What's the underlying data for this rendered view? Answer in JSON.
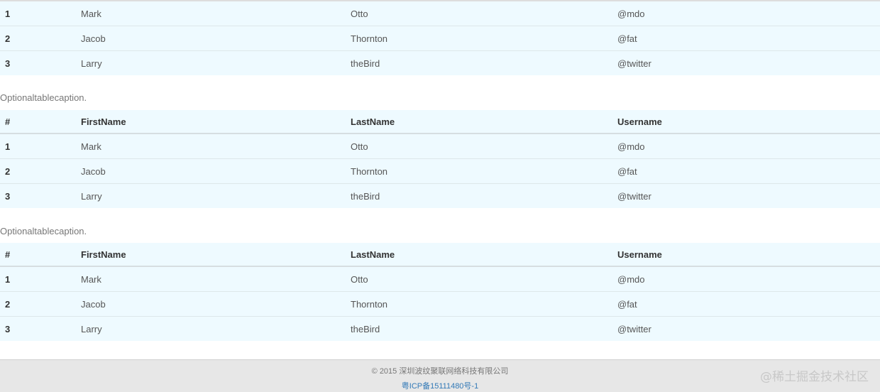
{
  "table1": {
    "rows": [
      {
        "num": "1",
        "first": "Mark",
        "last": "Otto",
        "user": "@mdo"
      },
      {
        "num": "2",
        "first": "Jacob",
        "last": "Thornton",
        "user": "@fat"
      },
      {
        "num": "3",
        "first": "Larry",
        "last": "theBird",
        "user": "@twitter"
      }
    ]
  },
  "table2": {
    "caption": "Optionaltablecaption.",
    "headers": {
      "num": "#",
      "first": "FirstName",
      "last": "LastName",
      "user": "Username"
    },
    "rows": [
      {
        "num": "1",
        "first": "Mark",
        "last": "Otto",
        "user": "@mdo"
      },
      {
        "num": "2",
        "first": "Jacob",
        "last": "Thornton",
        "user": "@fat"
      },
      {
        "num": "3",
        "first": "Larry",
        "last": "theBird",
        "user": "@twitter"
      }
    ]
  },
  "table3": {
    "caption": "Optionaltablecaption.",
    "headers": {
      "num": "#",
      "first": "FirstName",
      "last": "LastName",
      "user": "Username"
    },
    "rows": [
      {
        "num": "1",
        "first": "Mark",
        "last": "Otto",
        "user": "@mdo"
      },
      {
        "num": "2",
        "first": "Jacob",
        "last": "Thornton",
        "user": "@fat"
      },
      {
        "num": "3",
        "first": "Larry",
        "last": "theBird",
        "user": "@twitter"
      }
    ]
  },
  "footer": {
    "copyright": "© 2015 深圳波纹聚联网络科技有限公司",
    "icp": "粤ICP备15111480号-1",
    "watermark": "@稀土掘金技术社区"
  },
  "colors": {
    "row_background": "#eefaff",
    "footer_background": "#e7e7e7",
    "link": "#337ab7"
  }
}
